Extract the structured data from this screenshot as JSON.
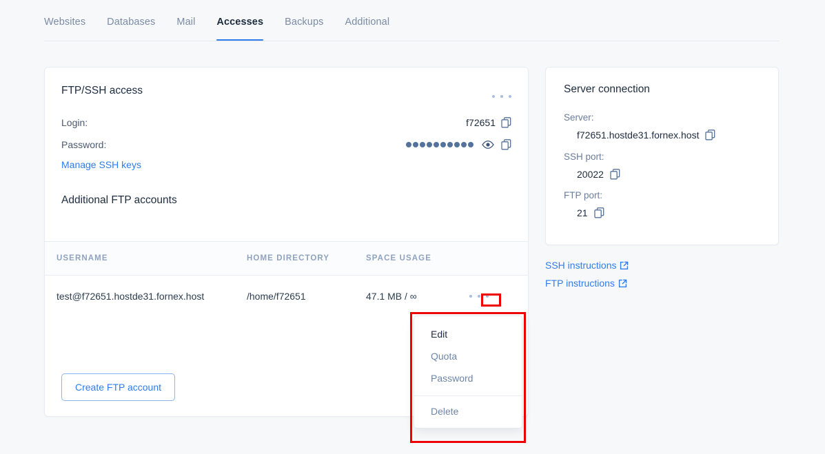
{
  "tabs": [
    {
      "label": "Websites",
      "active": false
    },
    {
      "label": "Databases",
      "active": false
    },
    {
      "label": "Mail",
      "active": false
    },
    {
      "label": "Accesses",
      "active": true
    },
    {
      "label": "Backups",
      "active": false
    },
    {
      "label": "Additional",
      "active": false
    }
  ],
  "ftp_card": {
    "title": "FTP/SSH access",
    "login_label": "Login:",
    "login_value": "f72651",
    "password_label": "Password:",
    "password_masked_dots": 10,
    "manage_ssh_keys_link": "Manage SSH keys",
    "subsection_title": "Additional FTP accounts",
    "create_button": "Create FTP account",
    "table": {
      "columns": [
        "USERNAME",
        "HOME DIRECTORY",
        "SPACE USAGE",
        ""
      ],
      "rows": [
        {
          "username": "test@f72651.hostde31.fornex.host",
          "home_directory": "/home/f72651",
          "space_usage": "47.1 MB / ∞"
        }
      ]
    }
  },
  "server_card": {
    "title": "Server connection",
    "fields": [
      {
        "label": "Server:",
        "value": "f72651.hostde31.fornex.host"
      },
      {
        "label": "SSH port:",
        "value": "20022"
      },
      {
        "label": "FTP port:",
        "value": "21"
      }
    ]
  },
  "instruction_links": [
    {
      "label": "SSH instructions"
    },
    {
      "label": "FTP instructions"
    }
  ],
  "context_menu": {
    "items": [
      {
        "label": "Edit",
        "emphasis": true
      },
      {
        "label": "Quota",
        "emphasis": false
      },
      {
        "label": "Password",
        "emphasis": false
      }
    ],
    "danger_item": {
      "label": "Delete"
    }
  },
  "colors": {
    "accent_blue": "#2f7ced",
    "annotation_red": "#ee0000",
    "text_dark": "#1d2b3f",
    "text_muted": "#6e86a8",
    "page_bg": "#f7f8f9"
  }
}
